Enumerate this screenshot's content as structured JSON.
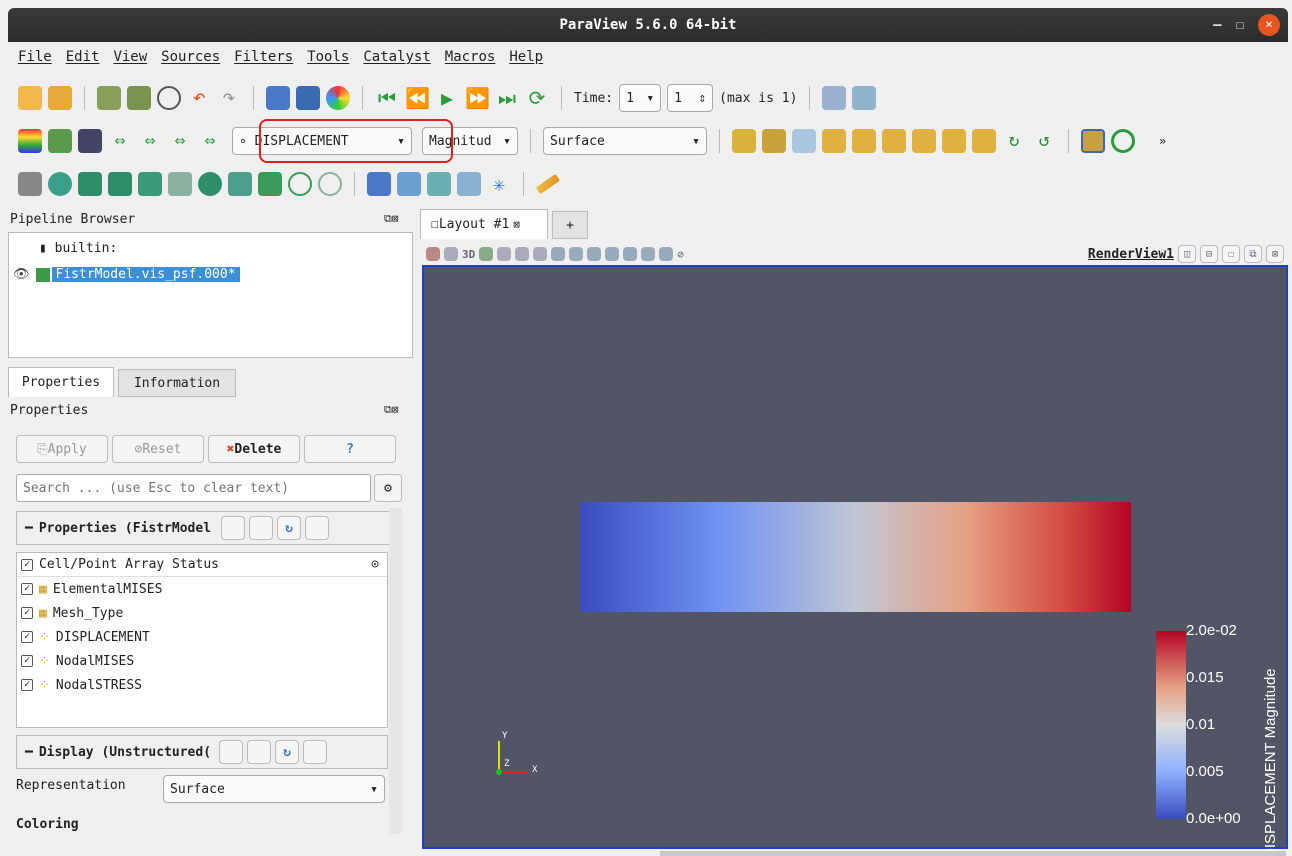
{
  "window": {
    "title": "ParaView 5.6.0 64-bit"
  },
  "menu": [
    "File",
    "Edit",
    "View",
    "Sources",
    "Filters",
    "Tools",
    "Catalyst",
    "Macros",
    "Help"
  ],
  "time": {
    "label": "Time:",
    "value": "1",
    "index": "1",
    "max": "(max is 1)"
  },
  "toolbar2": {
    "array": "DISPLACEMENT",
    "component": "Magnitud",
    "representation": "Surface"
  },
  "pipeline": {
    "title": "Pipeline Browser",
    "root": "builtin:",
    "item": "FistrModel.vis_psf.000*"
  },
  "tabs": {
    "properties": "Properties",
    "information": "Information"
  },
  "properties": {
    "title": "Properties",
    "apply": "Apply",
    "reset": "Reset",
    "delete": "Delete",
    "help": "?",
    "search_placeholder": "Search ... (use Esc to clear text)",
    "section1": "Properties (FistrModel",
    "array_status": "Cell/Point Array Status",
    "arrays": [
      "ElementalMISES",
      "Mesh_Type",
      "DISPLACEMENT",
      "NodalMISES",
      "NodalSTRESS"
    ],
    "section2": "Display (Unstructured(",
    "representation_label": "Representation",
    "representation_value": "Surface",
    "coloring": "Coloring"
  },
  "layout": {
    "tab": "Layout #1",
    "add": "+",
    "view_name": "RenderView1",
    "mode_3d": "3D"
  },
  "colorbar": {
    "title": "DISPLACEMENT Magnitude",
    "labels": [
      "2.0e-02",
      "0.015",
      "0.01",
      "0.005",
      "0.0e+00"
    ]
  },
  "axes": {
    "x": "X",
    "y": "Y",
    "z": "Z"
  },
  "colors": {
    "accent": "#1b3fd0",
    "highlight": "#e02020",
    "selection": "#3b8fd9",
    "view_bg": "#525566"
  }
}
